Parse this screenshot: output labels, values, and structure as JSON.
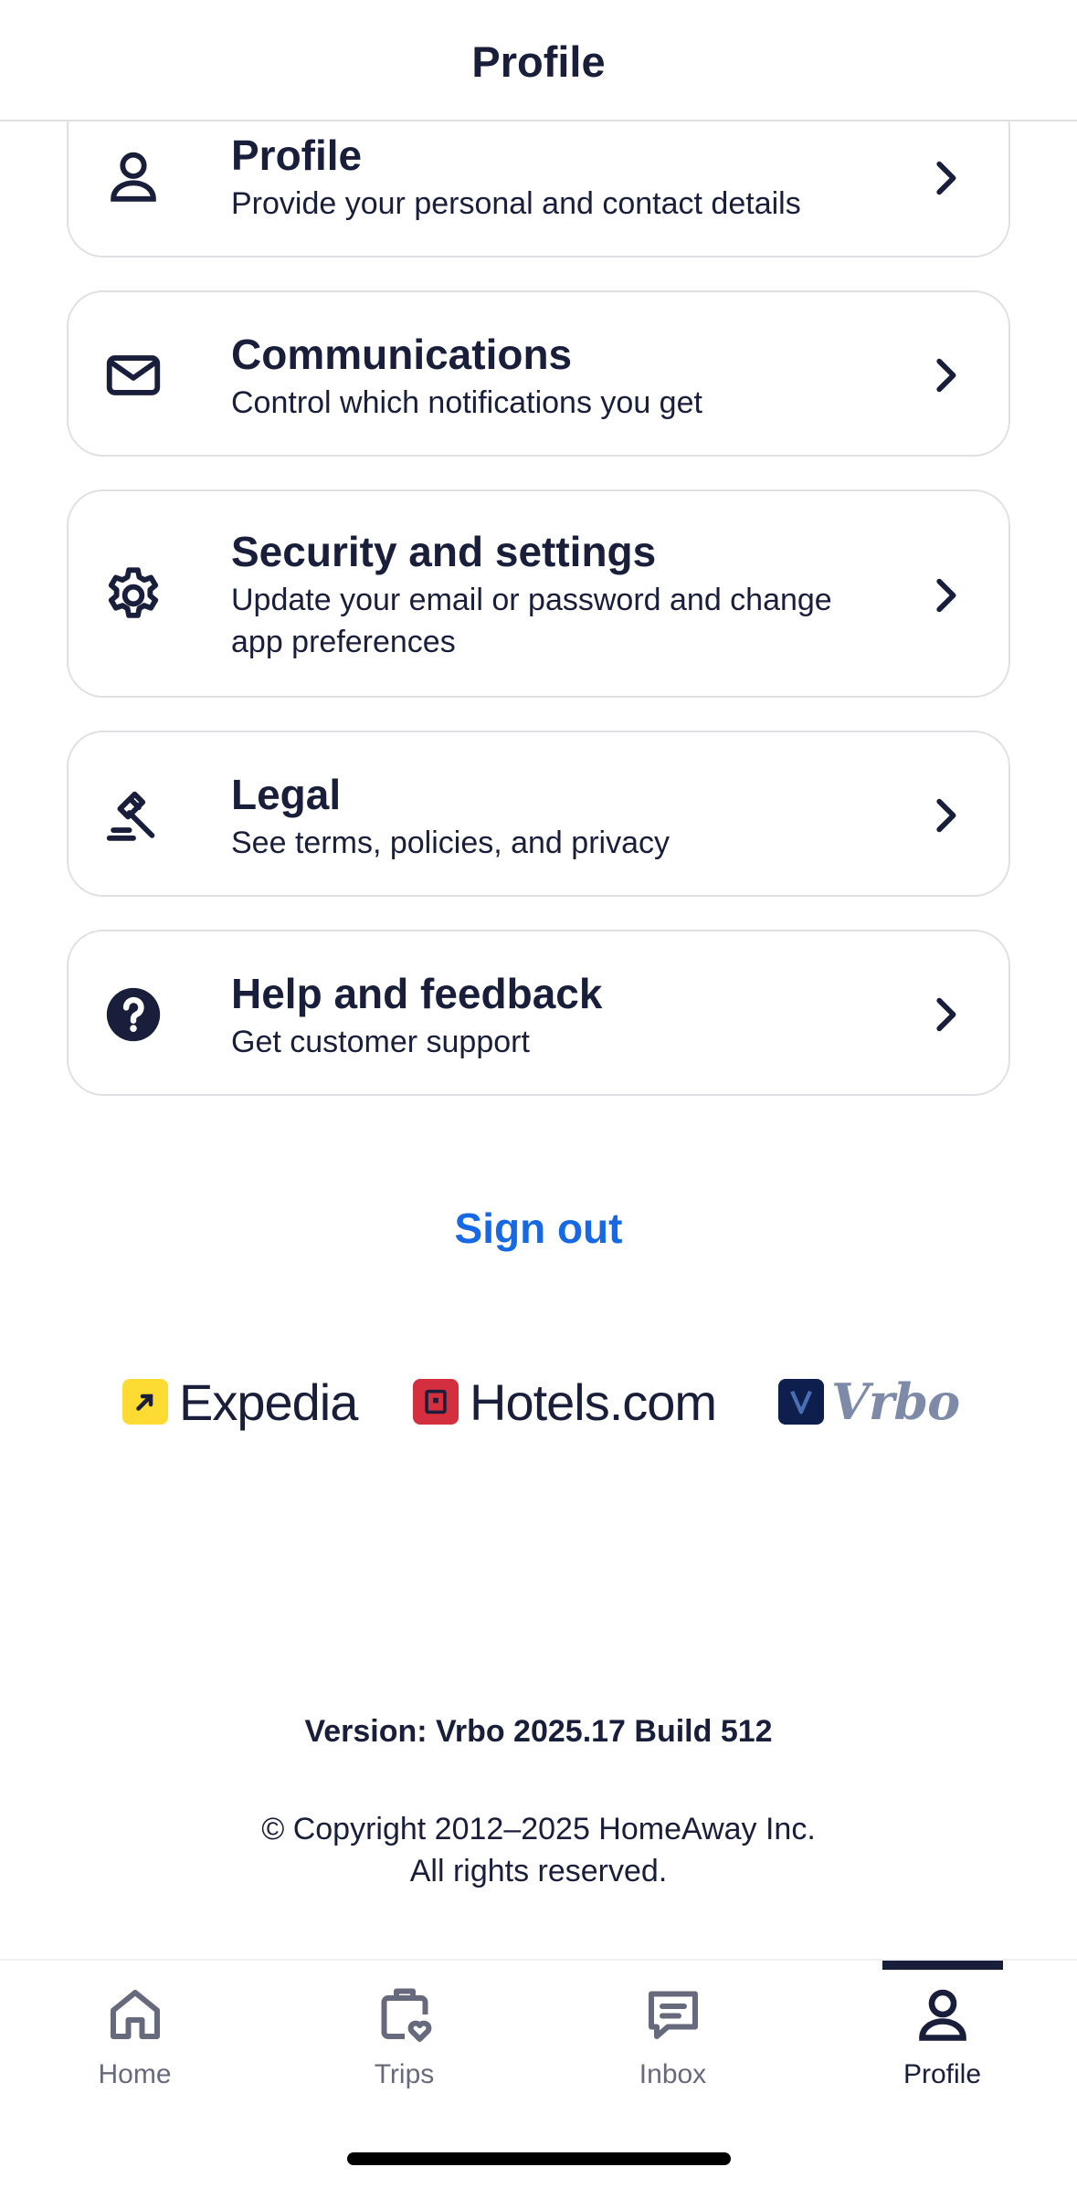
{
  "header": {
    "title": "Profile"
  },
  "menu": [
    {
      "title": "Profile",
      "subtitle": "Provide your personal and contact details",
      "icon": "person-icon"
    },
    {
      "title": "Communications",
      "subtitle": "Control which notifications you get",
      "icon": "envelope-icon"
    },
    {
      "title": "Security and settings",
      "subtitle": "Update your email or password and change app preferences",
      "icon": "gear-icon"
    },
    {
      "title": "Legal",
      "subtitle": "See terms, policies, and privacy",
      "icon": "gavel-icon"
    },
    {
      "title": "Help and feedback",
      "subtitle": "Get customer support",
      "icon": "help-circle-icon"
    }
  ],
  "sign_out_label": "Sign out",
  "brands": {
    "expedia": "Expedia",
    "hotels": "Hotels.com",
    "vrbo": "Vrbo"
  },
  "version": "Version: Vrbo 2025.17 Build 512",
  "copyright": {
    "line1": "© Copyright 2012–2025 HomeAway Inc.",
    "line2": "All rights reserved."
  },
  "tabs": [
    {
      "label": "Home",
      "icon": "home-icon",
      "active": false
    },
    {
      "label": "Trips",
      "icon": "luggage-heart-icon",
      "active": false
    },
    {
      "label": "Inbox",
      "icon": "chat-bubble-icon",
      "active": false
    },
    {
      "label": "Profile",
      "icon": "person-icon",
      "active": true
    }
  ],
  "colors": {
    "text": "#191e3b",
    "accent": "#1668e3",
    "border": "#dfe0e4",
    "muted": "#676a7d"
  }
}
